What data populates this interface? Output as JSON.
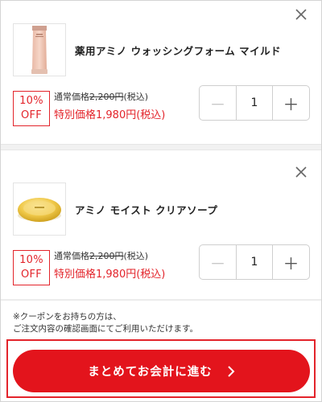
{
  "cart": {
    "items": [
      {
        "name": "薬用アミノ ウォッシングフォーム マイルド",
        "image_icon": "tube-product-image",
        "badge_pct": "10%",
        "badge_off": "OFF",
        "regular_prefix": "通常価格",
        "regular_amount": "2,200円",
        "regular_suffix": "(税込)",
        "sale_price": "特別価格1,980円(税込)",
        "quantity": "1",
        "minus_label": "－",
        "plus_label": "＋"
      },
      {
        "name": "アミノ モイスト クリアソープ",
        "image_icon": "soap-product-image",
        "badge_pct": "10%",
        "badge_off": "OFF",
        "regular_prefix": "通常価格",
        "regular_amount": "2,200円",
        "regular_suffix": "(税込)",
        "sale_price": "特別価格1,980円(税込)",
        "quantity": "1",
        "minus_label": "－",
        "plus_label": "＋"
      }
    ]
  },
  "coupon": {
    "line1": "※クーポンをお持ちの方は、",
    "line2": "ご注文内容の確認画面にてご利用いただけます。"
  },
  "checkout": {
    "label": "まとめてお会計に進む"
  },
  "colors": {
    "accent": "#e3141c",
    "text": "#222222",
    "border": "#cfcfcf"
  }
}
